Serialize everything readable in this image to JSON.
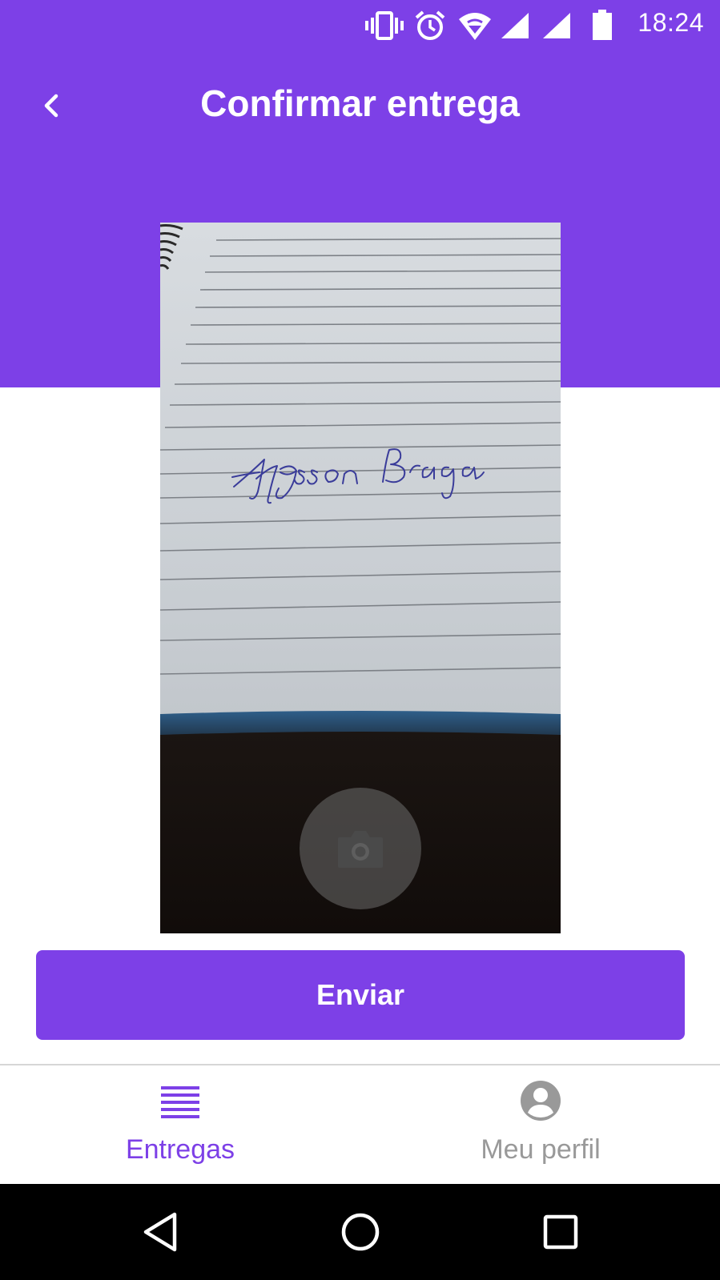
{
  "status_bar": {
    "time": "18:24",
    "icons": [
      "vibrate-icon",
      "alarm-icon",
      "wifi-icon",
      "signal-icon",
      "signal-icon",
      "battery-icon"
    ]
  },
  "header": {
    "title": "Confirmar entrega",
    "back_icon": "chevron-left-icon"
  },
  "photo": {
    "signature_text": "Elysson Braga",
    "camera_icon": "camera-icon"
  },
  "actions": {
    "submit_label": "Enviar"
  },
  "bottom_nav": {
    "tabs": [
      {
        "label": "Entregas",
        "icon": "list-icon",
        "active": true
      },
      {
        "label": "Meu perfil",
        "icon": "account-circle-icon",
        "active": false
      }
    ]
  },
  "system_nav": {
    "buttons": [
      "back-triangle-icon",
      "home-circle-icon",
      "recents-square-icon"
    ]
  },
  "colors": {
    "primary": "#7d40e7",
    "inactive": "#999999",
    "divider": "#d6d6d6"
  }
}
